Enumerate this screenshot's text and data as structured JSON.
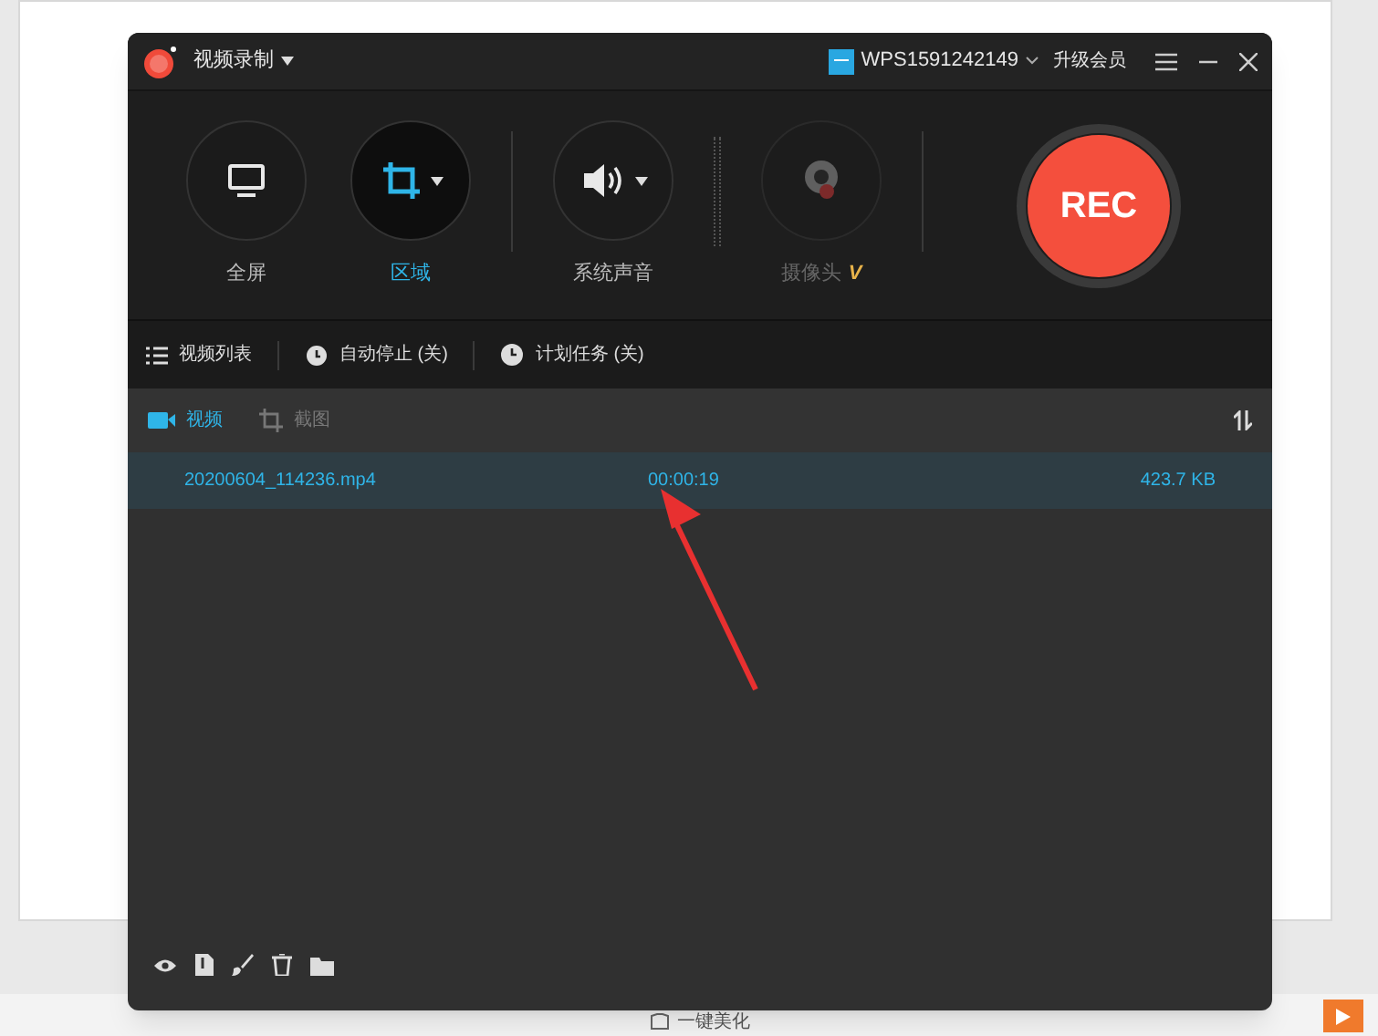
{
  "background": {
    "status_bar": {
      "beautify_label": "一键美化"
    }
  },
  "window": {
    "title": "视频录制",
    "account": "WPS1591242149",
    "upgrade": "升级会员"
  },
  "modes": [
    {
      "label": "全屏",
      "kind": "screen",
      "selected": false,
      "disabled": false
    },
    {
      "label": "区域",
      "kind": "region",
      "selected": true,
      "disabled": false
    },
    {
      "label": "系统声音",
      "kind": "sound",
      "selected": false,
      "disabled": false
    },
    {
      "label": "摄像头",
      "kind": "camera",
      "selected": false,
      "disabled": true,
      "badge": "V"
    }
  ],
  "rec_button": "REC",
  "toolbar": [
    {
      "label": "视频列表",
      "kind": "list"
    },
    {
      "label": "自动停止 (关)",
      "kind": "alarm"
    },
    {
      "label": "计划任务 (关)",
      "kind": "clock"
    }
  ],
  "tabs": [
    {
      "label": "视频",
      "kind": "video",
      "selected": true
    },
    {
      "label": "截图",
      "kind": "shot",
      "selected": false
    }
  ],
  "files": [
    {
      "name": "20200604_114236.mp4",
      "duration": "00:00:19",
      "size": "423.7 KB",
      "selected": true
    }
  ]
}
